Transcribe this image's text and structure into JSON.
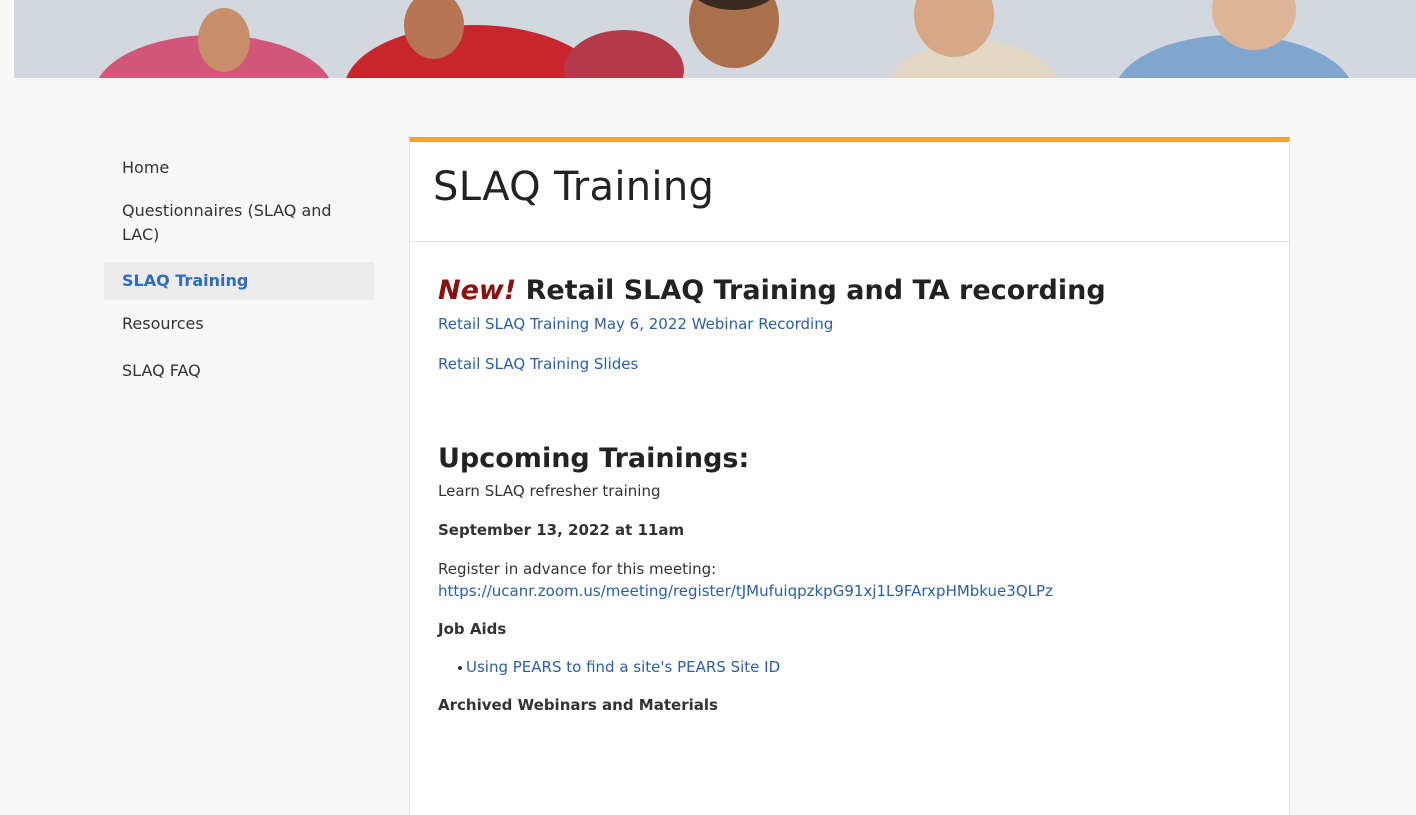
{
  "sidebar": {
    "items": [
      {
        "label": "Home",
        "active": false
      },
      {
        "label": "Questionnaires (SLAQ and LAC)",
        "active": false
      },
      {
        "label": "SLAQ Training",
        "active": true
      },
      {
        "label": "Resources",
        "active": false
      },
      {
        "label": "SLAQ FAQ",
        "active": false
      }
    ]
  },
  "main": {
    "page_title": "SLAQ Training",
    "section1": {
      "new_tag": "New!",
      "heading": " Retail SLAQ Training and TA recording",
      "links": [
        "Retail SLAQ Training May 6, 2022 Webinar Recording",
        "Retail SLAQ Training Slides"
      ]
    },
    "section2": {
      "heading": "Upcoming Trainings:",
      "description": "Learn SLAQ refresher training",
      "date": "September 13, 2022 at 11am",
      "register_text": "Register in advance for this meeting:",
      "register_link": "https://ucanr.zoom.us/meeting/register/tJMufuiqpzkpG91xj1L9FArxpHMbkue3QLPz",
      "job_aids_label": "Job Aids",
      "job_aids": [
        "Using PEARS to find a site's PEARS Site ID"
      ],
      "archived_label": "Archived Webinars and Materials"
    }
  },
  "colors": {
    "accent_bar": "#f0a81e",
    "link": "#2a5ea8",
    "active_nav": "#2d6cc0",
    "new_tag": "#8b1010"
  }
}
